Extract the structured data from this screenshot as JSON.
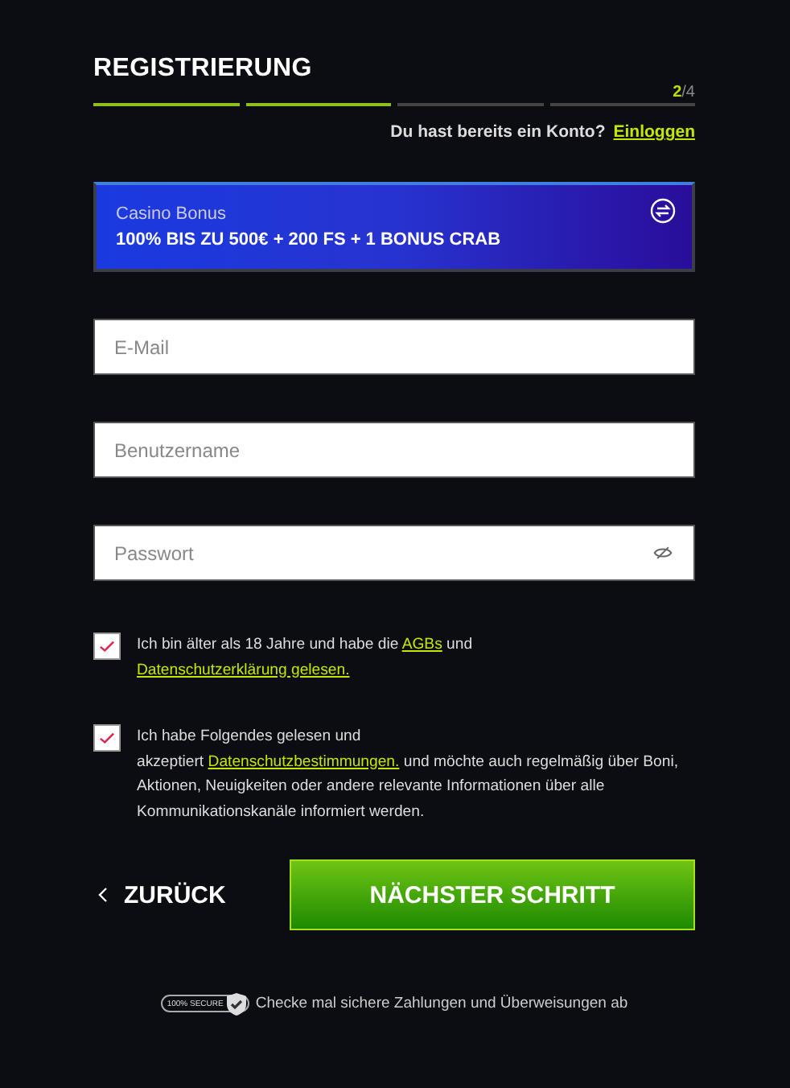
{
  "header": {
    "title": "REGISTRIERUNG",
    "step_current": "2",
    "step_total": "/4",
    "steps": [
      {
        "done": true
      },
      {
        "done": true
      },
      {
        "done": false
      },
      {
        "done": false
      }
    ],
    "login_prompt": "Du hast bereits ein Konto?",
    "login_link": "Einloggen"
  },
  "bonus": {
    "label": "Casino Bonus",
    "offer": "100% BIS ZU 500€ + 200 FS + 1 BONUS CRAB"
  },
  "fields": [
    {
      "placeholder": "E-Mail",
      "kind": "text"
    },
    {
      "placeholder": "Benutzername",
      "kind": "text"
    },
    {
      "placeholder": "Passwort",
      "kind": "password"
    }
  ],
  "consents": [
    {
      "checked": true,
      "segments": [
        {
          "kind": "text",
          "text": "Ich bin älter als 18 Jahre und habe die "
        },
        {
          "kind": "link",
          "text": "AGBs"
        },
        {
          "kind": "text",
          "text": " und"
        },
        {
          "kind": "break"
        },
        {
          "kind": "link",
          "text": "Datenschutzerklärung gelesen."
        }
      ]
    },
    {
      "checked": true,
      "segments": [
        {
          "kind": "text",
          "text": "Ich habe Folgendes gelesen und"
        },
        {
          "kind": "break"
        },
        {
          "kind": "text",
          "text": "akzeptiert "
        },
        {
          "kind": "link",
          "text": "Datenschutzbestimmungen."
        },
        {
          "kind": "text",
          "text": " und möchte auch regelmäßig über Boni, Aktionen, Neuigkeiten oder andere relevante Informationen über alle Kommunikationskanäle informiert werden."
        }
      ]
    }
  ],
  "back_button": "ZURÜCK",
  "next_button": "NÄCHSTER SCHRITT",
  "footer": {
    "badge": "100% SECURE",
    "text": "Checke mal sichere Zahlungen und Überweisungen ab"
  }
}
